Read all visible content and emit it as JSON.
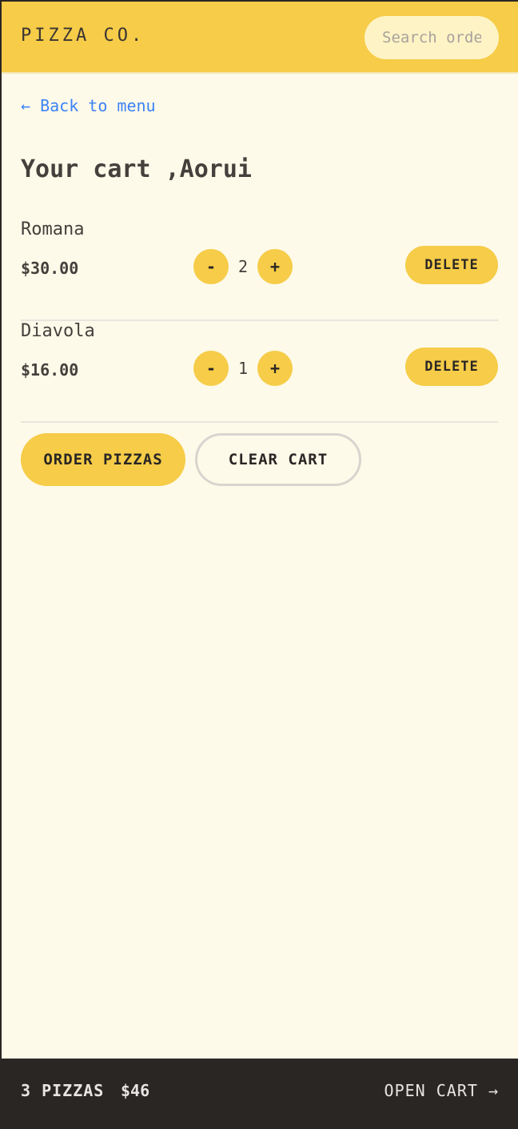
{
  "header": {
    "brand": "PIZZA CO.",
    "search_placeholder": "Search order #"
  },
  "nav": {
    "back_label": "← Back to menu"
  },
  "cart": {
    "title": "Your cart ,Aorui",
    "items": [
      {
        "name": "Romana",
        "price": "$30.00",
        "quantity": "2",
        "minus": "-",
        "plus": "+",
        "delete_label": "DELETE"
      },
      {
        "name": "Diavola",
        "price": "$16.00",
        "quantity": "1",
        "minus": "-",
        "plus": "+",
        "delete_label": "DELETE"
      }
    ],
    "order_label": "ORDER PIZZAS",
    "clear_label": "CLEAR CART"
  },
  "footer": {
    "quantity_label": "3 PIZZAS",
    "total": "$46",
    "open_cart_label": "OPEN CART →"
  },
  "colors": {
    "accent": "#f6cc48",
    "background": "#fefae9",
    "footer": "#2a2624",
    "link": "#3b82f6"
  }
}
